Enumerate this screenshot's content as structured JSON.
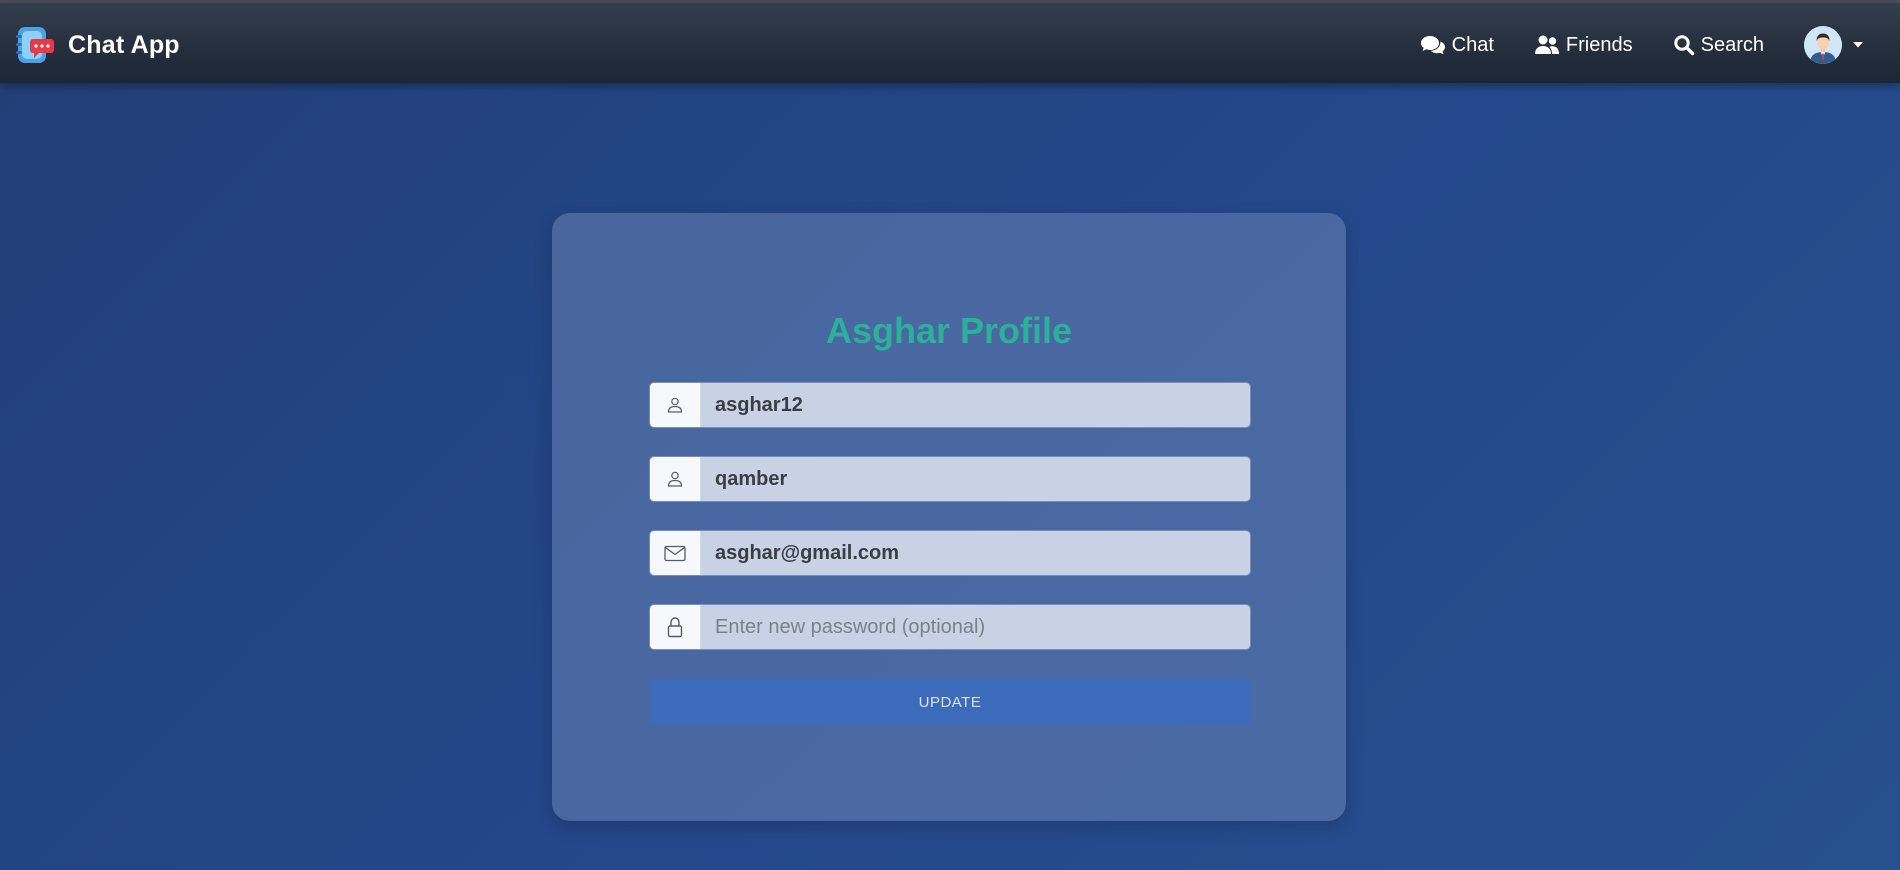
{
  "app": {
    "brand_name": "Chat App",
    "brand_icon": "chat-app-logo"
  },
  "nav": {
    "items": [
      {
        "label": "Chat",
        "icon": "comments-icon"
      },
      {
        "label": "Friends",
        "icon": "users-icon"
      },
      {
        "label": "Search",
        "icon": "search-icon"
      }
    ],
    "avatar_icon": "user-avatar",
    "dropdown_icon": "caret-down-icon"
  },
  "profile": {
    "title": "Asghar Profile",
    "fields": [
      {
        "icon": "person-icon",
        "value": "asghar12",
        "placeholder": ""
      },
      {
        "icon": "person-icon",
        "value": "qamber",
        "placeholder": ""
      },
      {
        "icon": "envelope-icon",
        "value": "asghar@gmail.com",
        "placeholder": ""
      },
      {
        "icon": "lock-icon",
        "value": "",
        "placeholder": "Enter new password (optional)"
      }
    ],
    "submit_label": "UPDATE"
  },
  "colors": {
    "title": "#2bb09a",
    "button": "#3d6bbb",
    "navbar": "#262f3d",
    "background": "#24478a"
  }
}
